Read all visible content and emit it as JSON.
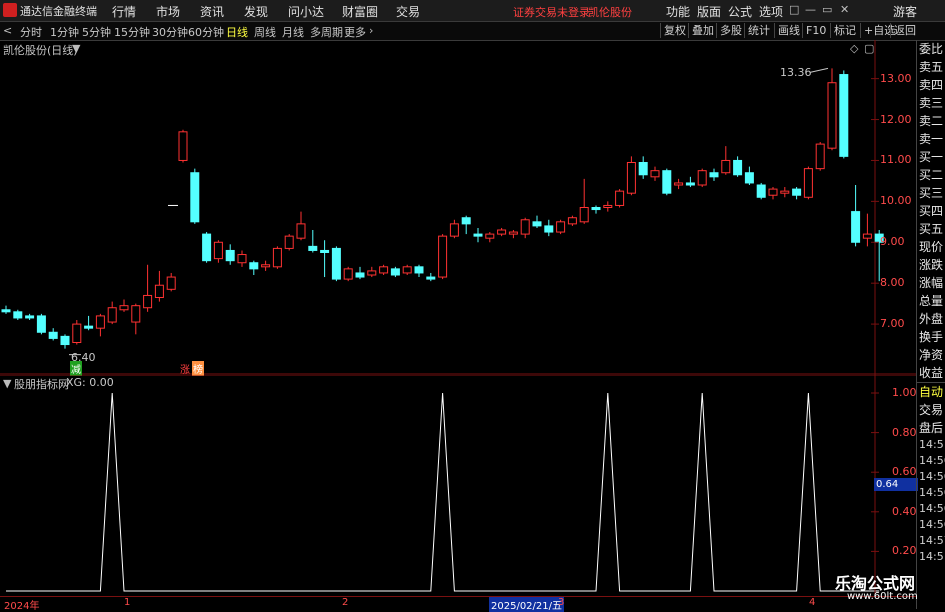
{
  "titlebar": {
    "app_name": "通达信金融终端",
    "menu": [
      "行情",
      "市场",
      "资讯",
      "发现",
      "问小达",
      "财富圈",
      "交易"
    ],
    "warning": "证券交易未登录",
    "stock": "凯伦股份",
    "right_menu": [
      "功能",
      "版面",
      "公式",
      "选项"
    ],
    "guest": "游客",
    "win_buttons": [
      "□",
      "—",
      "▭",
      "✕"
    ]
  },
  "toolbar": {
    "periods": [
      "分时",
      "1分钟",
      "5分钟",
      "15分钟",
      "30分钟",
      "60分钟",
      "日线",
      "周线",
      "月线",
      "多周期",
      "更多"
    ],
    "active_period": "日线",
    "buttons": [
      "复权",
      "叠加",
      "多股",
      "统计",
      "画线",
      "F10",
      "标记",
      "+自选",
      "返回"
    ]
  },
  "main_chart": {
    "title": "凯伦股份(日线)",
    "high_label": "13.36",
    "low_label": "6.40",
    "y_ticks": [
      "13.00",
      "12.00",
      "11.00",
      "10.00",
      "9.00",
      "8.00",
      "7.00"
    ],
    "badges": [
      {
        "text": "减",
        "color": "#20a020"
      },
      {
        "text": "涨",
        "color": "#ff4040"
      },
      {
        "text": "榜",
        "color": "#ff9040"
      }
    ]
  },
  "indicator": {
    "title": "股朋指标网",
    "readout": "XG: 0.00",
    "y_ticks": [
      "1.00",
      "0.80",
      "0.60",
      "0.40",
      "0.20"
    ],
    "cursor_value": "0.64"
  },
  "time_axis": {
    "labels": [
      "2024年",
      "1",
      "2",
      "3",
      "4"
    ],
    "cursor_date": "2025/02/21/五"
  },
  "side_panel": {
    "quote_items": [
      "委比",
      "卖五",
      "卖四",
      "卖三",
      "卖二",
      "卖一",
      "买一",
      "买二",
      "买三",
      "买四",
      "买五",
      "现价",
      "涨跌",
      "涨幅",
      "总量",
      "外盘",
      "换手",
      "净资",
      "收益"
    ],
    "trade_items": [
      "自动",
      "交易",
      "盘后"
    ],
    "times": [
      "14:5",
      "14:56",
      "14:56",
      "14:56",
      "14:56",
      "14:56",
      "14:57",
      "14:5"
    ]
  },
  "watermark": {
    "name": "乐淘公式网",
    "url": "www.60lt.com"
  },
  "colors": {
    "up": "#ff3232",
    "down": "#54ffff",
    "axis": "#ff4b4b",
    "grid": "#7a1010"
  },
  "chart_data": {
    "type": "candlestick",
    "series": [
      {
        "o": 7.35,
        "h": 7.45,
        "c": 7.3,
        "l": 7.25
      },
      {
        "o": 7.3,
        "h": 7.35,
        "c": 7.15,
        "l": 7.1
      },
      {
        "o": 7.2,
        "h": 7.25,
        "c": 7.15,
        "l": 7.1
      },
      {
        "o": 7.2,
        "h": 7.25,
        "c": 6.8,
        "l": 6.75
      },
      {
        "o": 6.8,
        "h": 6.9,
        "c": 6.65,
        "l": 6.6
      },
      {
        "o": 6.7,
        "h": 6.75,
        "c": 6.5,
        "l": 6.4
      },
      {
        "o": 6.55,
        "h": 7.1,
        "c": 7.0,
        "l": 6.5
      },
      {
        "o": 6.95,
        "h": 7.2,
        "c": 6.9,
        "l": 6.85
      },
      {
        "o": 6.9,
        "h": 7.25,
        "c": 7.2,
        "l": 6.7
      },
      {
        "o": 7.05,
        "h": 7.55,
        "c": 7.4,
        "l": 7.0
      },
      {
        "o": 7.35,
        "h": 7.6,
        "c": 7.45,
        "l": 7.3
      },
      {
        "o": 7.05,
        "h": 7.5,
        "c": 7.45,
        "l": 6.75
      },
      {
        "o": 7.4,
        "h": 8.45,
        "c": 7.7,
        "l": 7.3
      },
      {
        "o": 7.65,
        "h": 8.3,
        "c": 7.95,
        "l": 7.55
      },
      {
        "o": 7.85,
        "h": 8.25,
        "c": 8.15,
        "l": 7.8
      },
      {
        "o": 11.0,
        "h": 11.75,
        "c": 11.7,
        "l": 10.95
      },
      {
        "o": 10.7,
        "h": 10.8,
        "c": 9.5,
        "l": 9.45
      },
      {
        "o": 9.2,
        "h": 9.25,
        "c": 8.55,
        "l": 8.5
      },
      {
        "o": 8.6,
        "h": 9.05,
        "c": 9.0,
        "l": 8.5
      },
      {
        "o": 8.8,
        "h": 8.95,
        "c": 8.55,
        "l": 8.45
      },
      {
        "o": 8.5,
        "h": 8.8,
        "c": 8.7,
        "l": 8.4
      },
      {
        "o": 8.5,
        "h": 8.55,
        "c": 8.35,
        "l": 8.2
      },
      {
        "o": 8.4,
        "h": 8.55,
        "c": 8.45,
        "l": 8.3
      },
      {
        "o": 8.4,
        "h": 8.9,
        "c": 8.85,
        "l": 8.35
      },
      {
        "o": 8.85,
        "h": 9.2,
        "c": 9.15,
        "l": 8.8
      },
      {
        "o": 9.1,
        "h": 9.75,
        "c": 9.45,
        "l": 9.05
      },
      {
        "o": 8.9,
        "h": 9.3,
        "c": 8.8,
        "l": 8.75
      },
      {
        "o": 8.8,
        "h": 9.05,
        "c": 8.75,
        "l": 8.15
      },
      {
        "o": 8.85,
        "h": 8.9,
        "c": 8.1,
        "l": 8.05
      },
      {
        "o": 8.1,
        "h": 8.4,
        "c": 8.35,
        "l": 8.05
      },
      {
        "o": 8.25,
        "h": 8.4,
        "c": 8.15,
        "l": 8.1
      },
      {
        "o": 8.2,
        "h": 8.4,
        "c": 8.3,
        "l": 8.15
      },
      {
        "o": 8.25,
        "h": 8.45,
        "c": 8.4,
        "l": 8.2
      },
      {
        "o": 8.35,
        "h": 8.4,
        "c": 8.2,
        "l": 8.15
      },
      {
        "o": 8.25,
        "h": 8.45,
        "c": 8.4,
        "l": 8.2
      },
      {
        "o": 8.4,
        "h": 8.45,
        "c": 8.25,
        "l": 8.15
      },
      {
        "o": 8.15,
        "h": 8.25,
        "c": 8.1,
        "l": 8.05
      },
      {
        "o": 8.15,
        "h": 9.2,
        "c": 9.15,
        "l": 8.1
      },
      {
        "o": 9.15,
        "h": 9.55,
        "c": 9.45,
        "l": 9.1
      },
      {
        "o": 9.6,
        "h": 9.65,
        "c": 9.45,
        "l": 9.2
      },
      {
        "o": 9.2,
        "h": 9.35,
        "c": 9.15,
        "l": 9.0
      },
      {
        "o": 9.1,
        "h": 9.25,
        "c": 9.2,
        "l": 9.0
      },
      {
        "o": 9.2,
        "h": 9.35,
        "c": 9.3,
        "l": 9.15
      },
      {
        "o": 9.2,
        "h": 9.3,
        "c": 9.25,
        "l": 9.1
      },
      {
        "o": 9.2,
        "h": 9.6,
        "c": 9.55,
        "l": 9.1
      },
      {
        "o": 9.5,
        "h": 9.65,
        "c": 9.4,
        "l": 9.35
      },
      {
        "o": 9.4,
        "h": 9.55,
        "c": 9.25,
        "l": 9.15
      },
      {
        "o": 9.25,
        "h": 9.55,
        "c": 9.5,
        "l": 9.2
      },
      {
        "o": 9.45,
        "h": 9.65,
        "c": 9.6,
        "l": 9.4
      },
      {
        "o": 9.5,
        "h": 10.55,
        "c": 9.85,
        "l": 9.45
      },
      {
        "o": 9.85,
        "h": 9.9,
        "c": 9.8,
        "l": 9.7
      },
      {
        "o": 9.85,
        "h": 10.0,
        "c": 9.9,
        "l": 9.75
      },
      {
        "o": 9.9,
        "h": 10.3,
        "c": 10.25,
        "l": 9.85
      },
      {
        "o": 10.2,
        "h": 11.1,
        "c": 10.95,
        "l": 10.15
      },
      {
        "o": 10.95,
        "h": 11.1,
        "c": 10.65,
        "l": 10.55
      },
      {
        "o": 10.6,
        "h": 10.85,
        "c": 10.75,
        "l": 10.5
      },
      {
        "o": 10.75,
        "h": 10.8,
        "c": 10.2,
        "l": 10.15
      },
      {
        "o": 10.4,
        "h": 10.55,
        "c": 10.45,
        "l": 10.3
      },
      {
        "o": 10.45,
        "h": 10.6,
        "c": 10.4,
        "l": 10.35
      },
      {
        "o": 10.4,
        "h": 10.8,
        "c": 10.75,
        "l": 10.35
      },
      {
        "o": 10.7,
        "h": 10.8,
        "c": 10.6,
        "l": 10.5
      },
      {
        "o": 10.7,
        "h": 11.35,
        "c": 11.0,
        "l": 10.65
      },
      {
        "o": 11.0,
        "h": 11.1,
        "c": 10.65,
        "l": 10.6
      },
      {
        "o": 10.7,
        "h": 10.85,
        "c": 10.45,
        "l": 10.4
      },
      {
        "o": 10.4,
        "h": 10.45,
        "c": 10.1,
        "l": 10.05
      },
      {
        "o": 10.15,
        "h": 10.35,
        "c": 10.3,
        "l": 10.05
      },
      {
        "o": 10.2,
        "h": 10.35,
        "c": 10.25,
        "l": 10.1
      },
      {
        "o": 10.3,
        "h": 10.35,
        "c": 10.15,
        "l": 10.05
      },
      {
        "o": 10.1,
        "h": 10.85,
        "c": 10.8,
        "l": 10.05
      },
      {
        "o": 10.8,
        "h": 11.45,
        "c": 11.4,
        "l": 10.75
      },
      {
        "o": 11.3,
        "h": 13.25,
        "c": 12.9,
        "l": 11.25
      },
      {
        "o": 13.1,
        "h": 13.2,
        "c": 11.1,
        "l": 11.05
      },
      {
        "o": 9.75,
        "h": 10.4,
        "c": 9.0,
        "l": 8.9
      },
      {
        "o": 9.1,
        "h": 9.7,
        "c": 9.2,
        "l": 8.9
      },
      {
        "o": 9.2,
        "h": 9.3,
        "c": 9.0,
        "l": 8.05
      }
    ],
    "xg_signal_index": [
      9,
      37,
      51,
      59,
      68
    ],
    "ylim": [
      6.0,
      13.7
    ]
  }
}
